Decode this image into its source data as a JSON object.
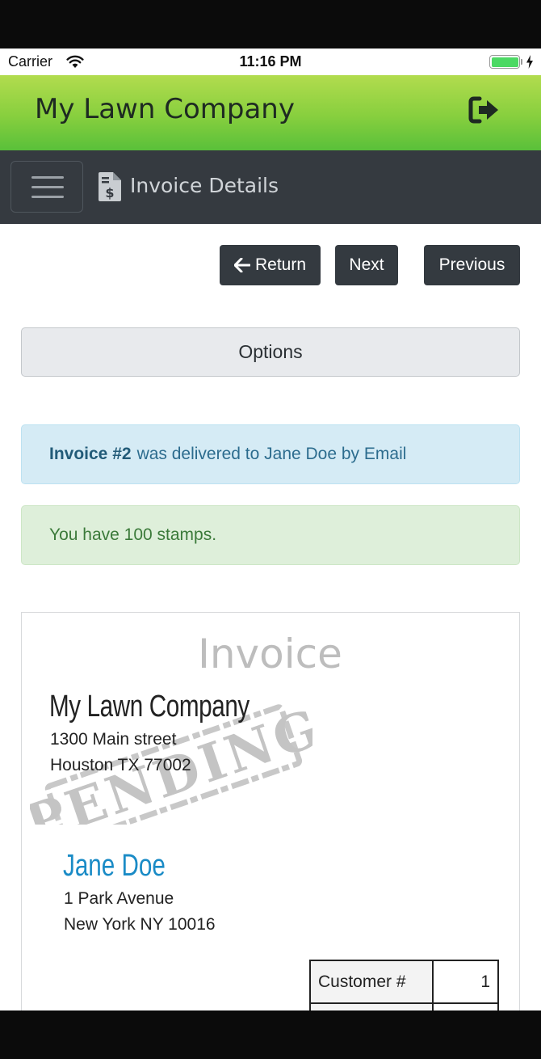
{
  "status_bar": {
    "carrier": "Carrier",
    "time": "11:16 PM",
    "battery_color": "#4cd964"
  },
  "header": {
    "app_title": "My Lawn Company",
    "logout_icon": "sign-out-icon",
    "gradient_colors": [
      "#b2dc4e",
      "#59c03a"
    ]
  },
  "navbar": {
    "page_title": "Invoice Details",
    "menu_icon": "hamburger-icon",
    "page_icon": "invoice-document-icon",
    "background": "#353a40"
  },
  "actions": {
    "return_label": "Return",
    "next_label": "Next",
    "previous_label": "Previous",
    "options_label": "Options"
  },
  "alerts": {
    "delivery_strong": "Invoice #2",
    "delivery_text": "was delivered to Jane Doe by Email",
    "stamps_text": "You have 100 stamps."
  },
  "invoice": {
    "heading": "Invoice",
    "stamp_text": "PENDING",
    "company": {
      "name": "My Lawn Company",
      "street": "1300 Main street",
      "city": "Houston TX 77002"
    },
    "client": {
      "name": "Jane Doe",
      "street": "1 Park Avenue",
      "city": "New York NY 10016"
    },
    "details": [
      {
        "label": "Customer #",
        "value": "1"
      }
    ]
  }
}
